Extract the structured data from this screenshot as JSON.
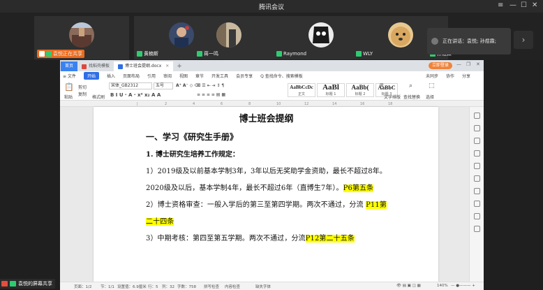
{
  "window": {
    "title": "腾讯会议",
    "controls": [
      "≡",
      "—",
      "☐",
      "✕"
    ]
  },
  "participants": [
    {
      "name": "袁悦正在共享"
    },
    {
      "name": "黄楠斯"
    },
    {
      "name": "蒋一鸣"
    },
    {
      "name": "Raymond"
    },
    {
      "name": "WLY"
    },
    {
      "name": "孙煜霖"
    }
  ],
  "speaking": {
    "label": "正在讲话：袁悦; 孙煜霖;"
  },
  "wps": {
    "home_tab": "首页",
    "tabs": [
      {
        "label": "找稻壳模板"
      },
      {
        "label": "博士班会提纲.docx"
      }
    ],
    "plus": "+",
    "login": "立即登录",
    "menu": [
      "≡ 文件",
      "开始",
      "插入",
      "页面布局",
      "引用",
      "审阅",
      "视图",
      "章节",
      "开发工具",
      "会员专享",
      "Q 查找命令、搜索模板"
    ],
    "menu_right": [
      "未同步",
      "协作",
      "分享"
    ],
    "ribbon": {
      "paste": "粘贴",
      "cut": "剪切",
      "copy": "复制",
      "format_painter": "格式刷",
      "font": "宋体_GB2312",
      "size": "五号",
      "styles": [
        {
          "preview": "AaBbCcDc",
          "label": "正文"
        },
        {
          "preview": "AaBl",
          "label": "标题 1"
        },
        {
          "preview": "AaBb(",
          "label": "标题 2"
        },
        {
          "preview": "AaBbC",
          "label": "标题 3"
        }
      ],
      "text_layout": "文字排版",
      "find_replace": "查找替换",
      "select": "选择"
    },
    "document": {
      "title": "博士班会提纲",
      "h1": "一、学习《研究生手册》",
      "h2": "1. 博士研究生培养工作规定：",
      "p1a": "1）2019级及以前基本学制3年，3年以后无奖助学金资助，最长不超过8年。2020级及以后，基本学制4年，最长不超过6年（直博生7年）。",
      "p1_hl": "P6第五条",
      "p2a": "2）博士资格审查：一般入学后的第三至第四学期。两次不通过，分流",
      "p2_hl": "P11第二十四条",
      "p3a": "3）中期考核：第四至第五学期。两次不通过，分流",
      "p3_hl": "P12第二十五条"
    },
    "status": {
      "page": "页面：1/2",
      "section": "节：1/1",
      "setting": "设置值：6.9厘米",
      "line": "行：5",
      "col": "列：32",
      "words": "字数：758",
      "spell": "拼写检查",
      "content_check": "内容检查",
      "missing_font": "缺失字体",
      "zoom": "140%"
    }
  },
  "share_bar": {
    "label": "袁悦的屏幕共享"
  },
  "colors": {
    "accent": "#2f6ee6",
    "highlight": "#ffff00",
    "login": "#f0833a"
  }
}
